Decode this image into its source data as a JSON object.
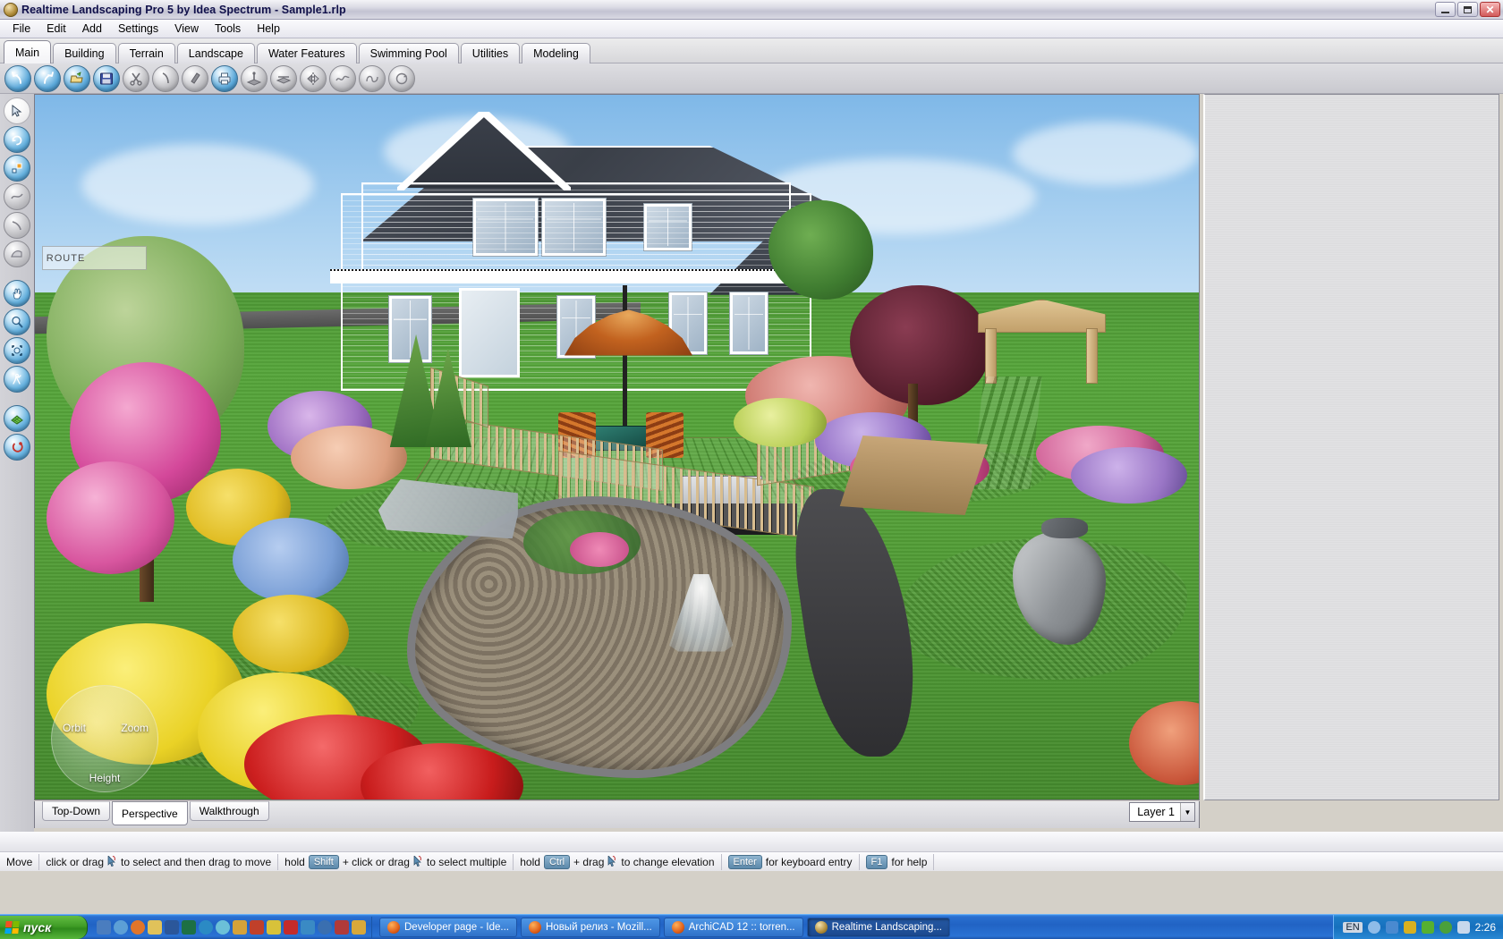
{
  "window": {
    "title": "Realtime Landscaping Pro 5 by Idea Spectrum - Sample1.rlp",
    "app_icon": "app-globe-icon",
    "buttons": {
      "minimize": "_",
      "maximize": "❐",
      "close": "✕"
    }
  },
  "menubar": {
    "items": [
      {
        "label": "File"
      },
      {
        "label": "Edit"
      },
      {
        "label": "Add"
      },
      {
        "label": "Settings"
      },
      {
        "label": "View"
      },
      {
        "label": "Tools"
      },
      {
        "label": "Help"
      }
    ]
  },
  "tabs": {
    "active": "Main",
    "items": [
      {
        "label": "Main"
      },
      {
        "label": "Building"
      },
      {
        "label": "Terrain"
      },
      {
        "label": "Landscape"
      },
      {
        "label": "Water Features"
      },
      {
        "label": "Swimming Pool"
      },
      {
        "label": "Utilities"
      },
      {
        "label": "Modeling"
      }
    ]
  },
  "toolbar": {
    "items": [
      {
        "name": "undo-icon",
        "enabled": true
      },
      {
        "name": "redo-icon",
        "enabled": true
      },
      {
        "name": "open-folder-icon",
        "enabled": true
      },
      {
        "name": "save-floppy-icon",
        "enabled": true
      },
      {
        "name": "cut-scissors-icon",
        "enabled": false
      },
      {
        "name": "copy-icon",
        "enabled": false
      },
      {
        "name": "paste-icon",
        "enabled": false
      },
      {
        "name": "print-icon",
        "enabled": true
      },
      {
        "name": "align-ground-icon",
        "enabled": false
      },
      {
        "name": "flatten-icon",
        "enabled": false
      },
      {
        "name": "mirror-icon",
        "enabled": false
      },
      {
        "name": "smooth-curve-icon",
        "enabled": false
      },
      {
        "name": "spline-icon",
        "enabled": false
      },
      {
        "name": "rotate-object-icon",
        "enabled": false
      }
    ]
  },
  "tool_rail": {
    "items": [
      {
        "name": "select-arrow-tool",
        "style": "white"
      },
      {
        "name": "rotate-tool",
        "style": "blue"
      },
      {
        "name": "scale-tool",
        "style": "blue"
      },
      {
        "name": "draw-curve-tool",
        "style": "gray"
      },
      {
        "name": "draw-line-tool",
        "style": "gray"
      },
      {
        "name": "draw-polygon-tool",
        "style": "gray"
      },
      {
        "name": "pan-hand-tool",
        "style": "blue"
      },
      {
        "name": "zoom-magnifier-tool",
        "style": "blue"
      },
      {
        "name": "zoom-window-tool",
        "style": "blue"
      },
      {
        "name": "walkthrough-tool",
        "style": "blue"
      },
      {
        "name": "terrain-grid-tool",
        "style": "blue"
      },
      {
        "name": "orbit-tool",
        "style": "blue"
      }
    ]
  },
  "viewport": {
    "name": "3d-design-viewport",
    "compass": {
      "orbit_label": "Orbit",
      "zoom_label": "Zoom",
      "height_label": "Height"
    },
    "watermark": "ROUTE"
  },
  "view_tabs": {
    "active": "Perspective",
    "items": [
      {
        "label": "Top-Down"
      },
      {
        "label": "Perspective"
      },
      {
        "label": "Walkthrough"
      }
    ]
  },
  "layer_selector": {
    "value": "Layer 1",
    "arrow": "▼"
  },
  "status_bar": {
    "mode": "Move",
    "segments": [
      {
        "id": "mode",
        "text": "Move"
      },
      {
        "id": "select-move",
        "pre": "click or drag",
        "icon": "mouse-cursor-icon",
        "post": "to select and then drag to move"
      },
      {
        "id": "multi-select",
        "pre": "hold",
        "key": "Shift",
        "mid": "+ click or drag",
        "icon": "mouse-cursor-icon",
        "post": "to select multiple"
      },
      {
        "id": "elevation",
        "pre": "hold",
        "key": "Ctrl",
        "mid": "+ drag",
        "icon": "mouse-cursor-icon",
        "post": "to change elevation"
      },
      {
        "id": "keyboard-entry",
        "key": "Enter",
        "post": "for keyboard entry"
      },
      {
        "id": "help",
        "key": "F1",
        "post": "for help"
      }
    ]
  },
  "taskbar": {
    "start_label": "пуск",
    "quick_launch": [
      {
        "name": "quicklaunch-icon-1",
        "color": "#4a7dbf"
      },
      {
        "name": "quicklaunch-icon-ie",
        "color": "#5c9fd6"
      },
      {
        "name": "quicklaunch-icon-firefox",
        "color": "#e0752a"
      },
      {
        "name": "quicklaunch-icon-paint",
        "color": "#e0c25a"
      },
      {
        "name": "quicklaunch-icon-word",
        "color": "#2b579a"
      },
      {
        "name": "quicklaunch-icon-excel",
        "color": "#1d7044"
      },
      {
        "name": "quicklaunch-icon-media-player",
        "color": "#2b8ac4"
      },
      {
        "name": "quicklaunch-icon-disc",
        "color": "#6bc0d8"
      },
      {
        "name": "quicklaunch-icon-folder",
        "color": "#d4a23a"
      },
      {
        "name": "quicklaunch-icon-runner",
        "color": "#c0402a"
      },
      {
        "name": "quicklaunch-icon-flash",
        "color": "#d8c23a"
      },
      {
        "name": "quicklaunch-icon-acrobat",
        "color": "#c42b2b"
      },
      {
        "name": "quicklaunch-icon-battery",
        "color": "#3a8ac4"
      },
      {
        "name": "quicklaunch-icon-globe",
        "color": "#3a6fb0"
      },
      {
        "name": "quicklaunch-icon-volume",
        "color": "#b03a3a"
      },
      {
        "name": "quicklaunch-icon-clock",
        "color": "#d8a83a"
      }
    ],
    "items": [
      {
        "label": "Developer page - Ide...",
        "icon": "firefox-icon",
        "active": false
      },
      {
        "label": "Новый релиз - Mozill...",
        "icon": "firefox-icon",
        "active": false
      },
      {
        "label": "ArchiCAD 12 :: torren...",
        "icon": "firefox-icon",
        "active": false
      },
      {
        "label": "Realtime Landscaping...",
        "icon": "app-globe-icon",
        "active": true
      }
    ],
    "tray": {
      "language": "EN",
      "icons": [
        {
          "name": "tray-show-hide-icon",
          "color": "#8fbce8"
        },
        {
          "name": "tray-network-icon",
          "color": "#4a8ad0"
        },
        {
          "name": "tray-antivirus-icon",
          "color": "#d8b020"
        },
        {
          "name": "tray-nvidia-icon",
          "color": "#56b030"
        },
        {
          "name": "tray-shield-icon",
          "color": "#4aa03a"
        },
        {
          "name": "tray-mail-icon",
          "color": "#c8d8ec"
        }
      ],
      "clock": "2:26"
    }
  },
  "colors": {
    "titlebar_text": "#10104a",
    "taskbar_blue": "#2163c4",
    "start_green": "#3f9c26",
    "accent_key": "#5c89ab",
    "grass": "#54a038",
    "sky": "#8fc4ea",
    "house_siding": "#c3d6cb",
    "deck_wood": "#c2a177"
  }
}
